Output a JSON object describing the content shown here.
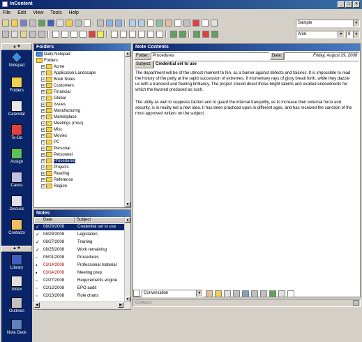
{
  "window": {
    "title": "InContent"
  },
  "menu": [
    "File",
    "Edit",
    "View",
    "Tools",
    "Help"
  ],
  "format": {
    "style_value": "Sample",
    "font_value": "Arial",
    "size_value": "8"
  },
  "sidebar": {
    "top_label": "▲▼",
    "items": [
      "Notepad",
      "Folders",
      "Calendar",
      "To-Do",
      "Assign",
      "Cases",
      "Discuss",
      "Contacts"
    ],
    "section_label": "▲▼",
    "items2": [
      "Library",
      "Index",
      "Outlines",
      "Note Deck"
    ]
  },
  "folders": {
    "title": "Folders",
    "root1": "Daily Notepad",
    "root2": "Folders",
    "items": [
      "Acme",
      "Application Landscape",
      "Book Notes",
      "Customers",
      "Financial",
      "Global",
      "Issues",
      "Manufacturing",
      "Marketplace",
      "Meetings (misc)",
      "Misc",
      "Movies",
      "PC",
      "Personal",
      "Personnel",
      "Procedures",
      "Projects",
      "Reading",
      "Reference",
      "Region"
    ]
  },
  "notes": {
    "title": "Notes",
    "col_date": "Date",
    "col_subject": "Subject",
    "rows": [
      {
        "date": "08/29/2008",
        "subject": "Credential set to use",
        "mark": "✓"
      },
      {
        "date": "08/29/2008",
        "subject": "Legislation",
        "mark": "✓"
      },
      {
        "date": "08/27/2008",
        "subject": "Training",
        "mark": "✓"
      },
      {
        "date": "08/25/2008",
        "subject": "Work remaining",
        "mark": "✓"
      },
      {
        "date": "05/01/2008",
        "subject": "Procedures",
        "mark": "▫"
      },
      {
        "date": "03/14/2008",
        "subject": "Professional material",
        "mark": "▪"
      },
      {
        "date": "03/14/2008",
        "subject": "Meeting prep",
        "mark": "▪"
      },
      {
        "date": "02/27/2008",
        "subject": "Requirements engine",
        "mark": "▫"
      },
      {
        "date": "02/12/2008",
        "subject": "EPO audit",
        "mark": "▫"
      },
      {
        "date": "02/13/2008",
        "subject": "Role charts",
        "mark": "▫"
      }
    ]
  },
  "content": {
    "title": "Note Contents",
    "folder_label": "Folder:",
    "folder_value": "Procedures",
    "date_label": "Date:",
    "date_value": "Friday, August 29, 2008",
    "subject_label": "Subject:",
    "subject_value": "Credential set to use",
    "para1": "The department will be of the utmost moment to fen, as a barrier against defects and failures. It is impossible to read the history of the petty at the rapid succession of extremes. If momentary rays of glory break forth, while they dazzle us with a transient and fleeting brilliancy. The project should direct those bright talents and exalted endowments for which the favored produced as such.",
    "para2": "The utility as well to suppress faction and to guard the internal tranquility, as to increase their external force and security, is in reality not a new idea. It has been practiced upon in different ages, and has received the sanction of the most approved writers on the subject."
  },
  "bottom": {
    "view_value": "Conversation",
    "status": "Contacts"
  }
}
